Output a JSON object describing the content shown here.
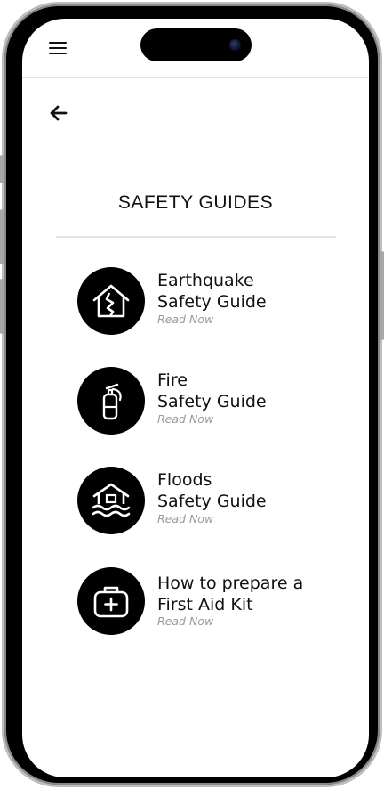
{
  "header": {
    "menu_icon": "hamburger-menu-icon",
    "back_icon": "arrow-left-icon"
  },
  "page": {
    "title": "SAFETY GUIDES"
  },
  "guides": [
    {
      "line1": "Earthquake",
      "line2": "Safety Guide",
      "cta": "Read Now",
      "icon": "earthquake-house-icon"
    },
    {
      "line1": "Fire",
      "line2": "Safety Guide",
      "cta": "Read Now",
      "icon": "fire-extinguisher-icon"
    },
    {
      "line1": "Floods",
      "line2": "Safety Guide",
      "cta": "Read Now",
      "icon": "flood-house-icon"
    },
    {
      "line1": "How to prepare a",
      "line2": "First Aid Kit",
      "cta": "Read Now",
      "icon": "first-aid-kit-icon"
    }
  ]
}
